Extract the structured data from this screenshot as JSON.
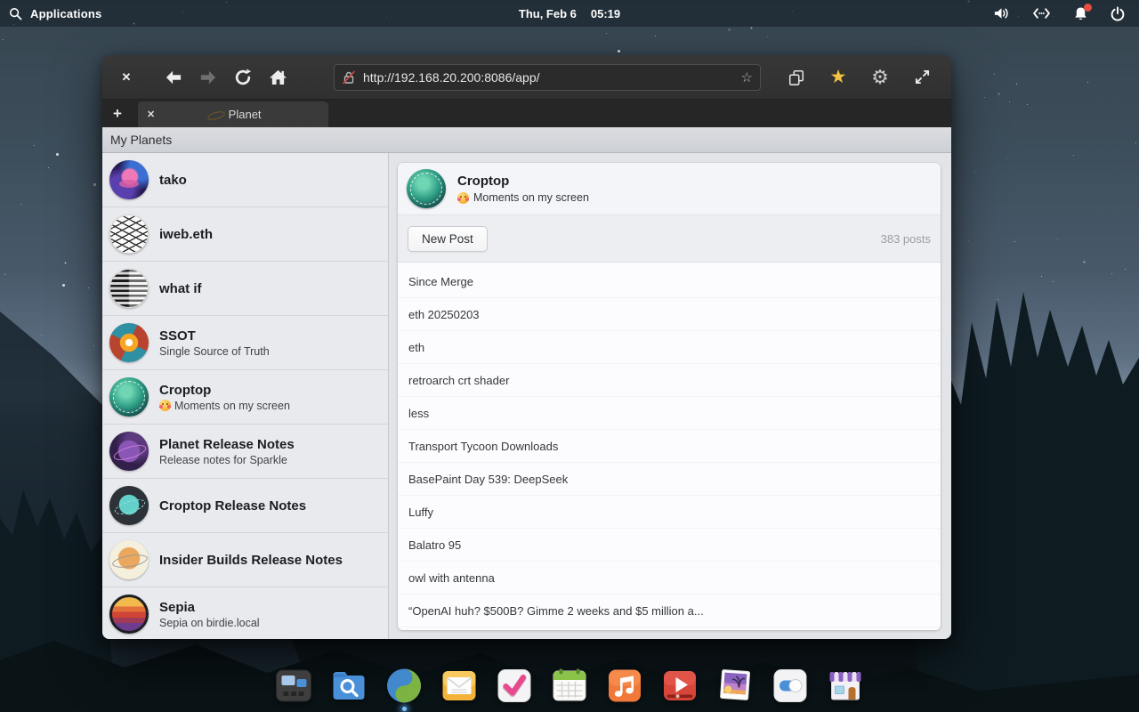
{
  "topbar": {
    "applications": "Applications",
    "date": "Thu, Feb 6",
    "time": "05:19",
    "icons": [
      "search-icon",
      "volume-icon",
      "network-icon",
      "notifications-icon",
      "power-icon"
    ],
    "notification_badge_color": "#e84e40"
  },
  "browser": {
    "url": "http://192.168.20.200:8086/app/",
    "tab_title": "Planet",
    "toolbar_icons": [
      "close-icon",
      "back-icon",
      "forward-icon",
      "reload-icon",
      "home-icon",
      "insecure-lock-icon",
      "bookmark-outline-icon",
      "copy-icon",
      "bookmarks-star-icon",
      "gear-icon",
      "fullscreen-icon"
    ],
    "new_tab_label": "+",
    "accent_star_color": "#f6c242"
  },
  "app": {
    "header_title": "My Planets",
    "sidebar": {
      "items": [
        {
          "title": "tako",
          "avatar": "tako"
        },
        {
          "title": "iweb.eth",
          "avatar": "iweb"
        },
        {
          "title": "what if",
          "avatar": "whatif"
        },
        {
          "title": "SSOT",
          "subtitle": "Single Source of Truth",
          "avatar": "ssot"
        },
        {
          "title": "Croptop",
          "subtitle": "Moments on my screen",
          "subtitle_emoji": "🥰",
          "avatar": "croptop"
        },
        {
          "title": "Planet Release Notes",
          "subtitle": "Release notes for Sparkle",
          "avatar": "planetrn"
        },
        {
          "title": "Croptop Release Notes",
          "avatar": "croptoprn"
        },
        {
          "title": "Insider Builds Release Notes",
          "avatar": "insider"
        },
        {
          "title": "Sepia",
          "subtitle": "Sepia on birdie.local",
          "avatar": "sepia"
        }
      ]
    },
    "main": {
      "planet_name": "Croptop",
      "about_emoji": "🥰",
      "about": "Moments on my screen",
      "new_post": "New Post",
      "post_count": "383 posts",
      "posts": [
        "Since Merge",
        "eth 20250203",
        "eth",
        "retroarch crt shader",
        "less",
        "Transport Tycoon Downloads",
        "BasePaint Day 539: DeepSeek",
        "Luffy",
        "Balatro 95",
        "owl with antenna",
        "“OpenAI huh? $500B? Gimme 2 weeks and $5 million a..."
      ]
    }
  },
  "dock": {
    "items": [
      {
        "icon": "multitasking-view"
      },
      {
        "icon": "file-search"
      },
      {
        "icon": "web-browser",
        "running": true
      },
      {
        "icon": "mail"
      },
      {
        "icon": "tasks"
      },
      {
        "icon": "calendar"
      },
      {
        "icon": "music"
      },
      {
        "icon": "videos"
      },
      {
        "icon": "photos"
      },
      {
        "icon": "settings"
      },
      {
        "icon": "appcenter"
      }
    ]
  }
}
